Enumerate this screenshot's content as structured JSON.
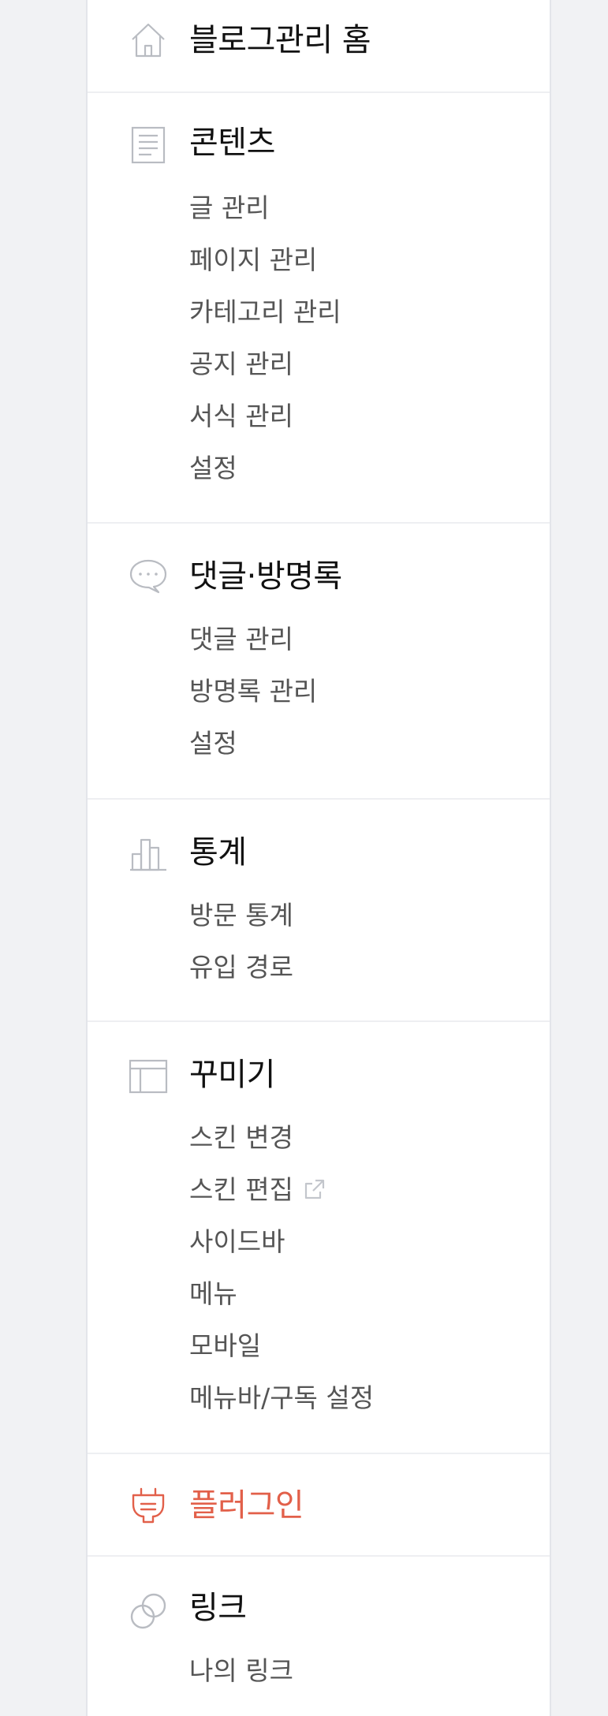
{
  "sections": {
    "home": {
      "title": "블로그관리 홈",
      "icon": "home-icon"
    },
    "contents": {
      "title": "콘텐츠",
      "icon": "document-icon",
      "items": [
        {
          "label": "글 관리"
        },
        {
          "label": "페이지 관리"
        },
        {
          "label": "카테고리 관리"
        },
        {
          "label": "공지 관리"
        },
        {
          "label": "서식 관리"
        },
        {
          "label": "설정"
        }
      ]
    },
    "comments": {
      "title": "댓글·방명록",
      "icon": "speech-bubble-icon",
      "items": [
        {
          "label": "댓글 관리"
        },
        {
          "label": "방명록 관리"
        },
        {
          "label": "설정"
        }
      ]
    },
    "stats": {
      "title": "통계",
      "icon": "bar-chart-icon",
      "items": [
        {
          "label": "방문 통계"
        },
        {
          "label": "유입 경로"
        }
      ]
    },
    "design": {
      "title": "꾸미기",
      "icon": "layout-icon",
      "items": [
        {
          "label": "스킨 변경"
        },
        {
          "label": "스킨 편집",
          "trailing_icon": "external-link-icon"
        },
        {
          "label": "사이드바"
        },
        {
          "label": "메뉴"
        },
        {
          "label": "모바일"
        },
        {
          "label": "메뉴바/구독 설정"
        }
      ]
    },
    "plugin": {
      "title": "플러그인",
      "icon": "plug-icon"
    },
    "link": {
      "title": "링크",
      "icon": "link-icon",
      "items": [
        {
          "label": "나의 링크"
        }
      ]
    }
  },
  "colors": {
    "page_background": "#f1f2f4",
    "panel_background": "#ffffff",
    "title_text": "#111111",
    "item_text": "#555555",
    "icon_gray": "#b9bcc2",
    "plugin_accent": "#e2604a",
    "divider": "#eeeff2"
  }
}
